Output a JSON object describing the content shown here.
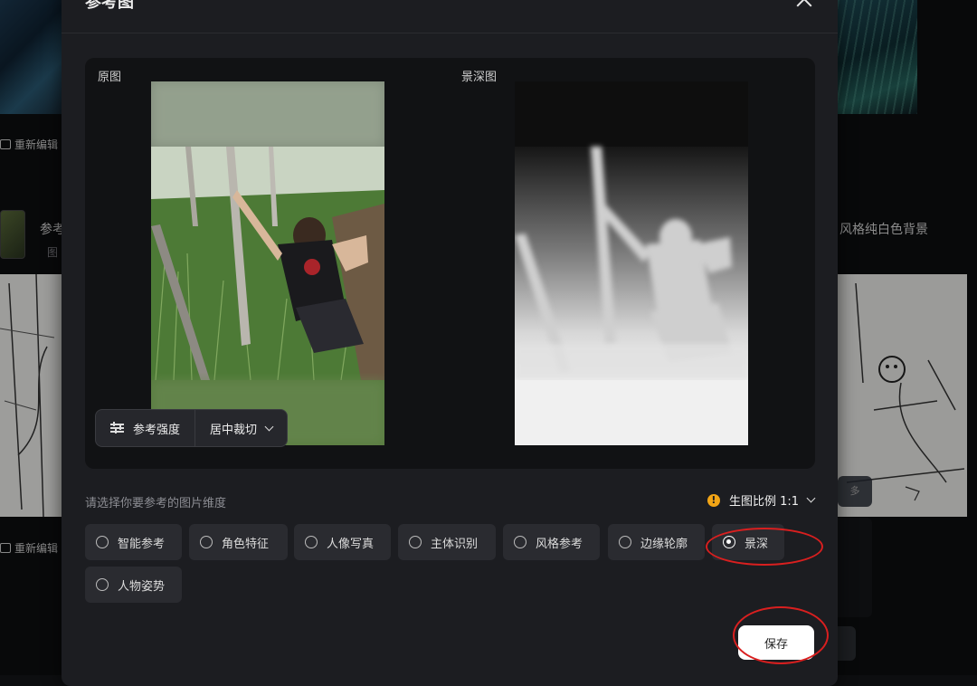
{
  "modal": {
    "title": "参考图",
    "preview": {
      "original_label": "原图",
      "depth_label": "景深图"
    },
    "toolbar": {
      "strength_label": "参考强度",
      "crop_label": "居中裁切"
    },
    "dimension_prompt": "请选择你要参考的图片维度",
    "ratio_label": "生图比例 1:1",
    "options": [
      {
        "label": "智能参考",
        "selected": false
      },
      {
        "label": "角色特征",
        "selected": false
      },
      {
        "label": "人像写真",
        "selected": false
      },
      {
        "label": "主体识别",
        "selected": false
      },
      {
        "label": "风格参考",
        "selected": false
      },
      {
        "label": "边缘轮廓",
        "selected": false
      },
      {
        "label": "景深",
        "selected": true
      },
      {
        "label": "人物姿势",
        "selected": false
      }
    ],
    "save_label": "保存"
  },
  "background": {
    "edit_label_1": "重新编辑",
    "edit_label_2": "重新编辑",
    "item_title": "参考",
    "item_sub": "图",
    "right_caption": "风格纯白色背景",
    "pill_text": "多"
  },
  "colors": {
    "modal_bg": "#1c1d21",
    "option_bg": "#2a2b30",
    "warning": "#f2a516",
    "annotation": "#d91f1f",
    "save_bg": "#ffffff"
  }
}
